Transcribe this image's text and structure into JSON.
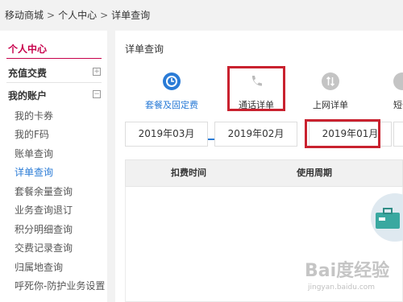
{
  "breadcrumb": {
    "home": "移动商城",
    "sep": ">",
    "center": "个人中心",
    "current": "详单查询"
  },
  "sidebar": {
    "title": "个人中心",
    "recharge": "充值交费",
    "recharge_icon": "plus-square-icon",
    "account": "我的账户",
    "account_icon": "minus-square-icon",
    "items": [
      {
        "label": "我的卡券"
      },
      {
        "label": "我的F码"
      },
      {
        "label": "账单查询"
      },
      {
        "label": "详单查询"
      },
      {
        "label": "套餐余量查询"
      },
      {
        "label": "业务查询退订"
      },
      {
        "label": "积分明细查询"
      },
      {
        "label": "交费记录查询"
      },
      {
        "label": "归属地查询"
      },
      {
        "label": "呼死你-防护业务设置"
      }
    ],
    "active_item": "详单查询"
  },
  "main": {
    "title": "详单查询",
    "tabs": [
      {
        "label": "套餐及固定费",
        "icon": "clock-icon",
        "active": true
      },
      {
        "label": "通话详单",
        "icon": "phone-icon",
        "active": false
      },
      {
        "label": "上网详单",
        "icon": "data-arrows-icon",
        "active": false
      },
      {
        "label": "短信",
        "icon": "message-icon",
        "active": false
      }
    ],
    "months": [
      {
        "label": "2019年03月"
      },
      {
        "label": "2019年02月"
      },
      {
        "label": "2019年01月"
      }
    ],
    "table_headers": [
      "扣费时间",
      "使用周期"
    ]
  },
  "colors": {
    "accent": "#2a7bd6",
    "brand": "#c7004b",
    "highlight": "#c9222f"
  },
  "watermark": {
    "text": "Bai度经验",
    "sub": "jingyan.baidu.com"
  }
}
